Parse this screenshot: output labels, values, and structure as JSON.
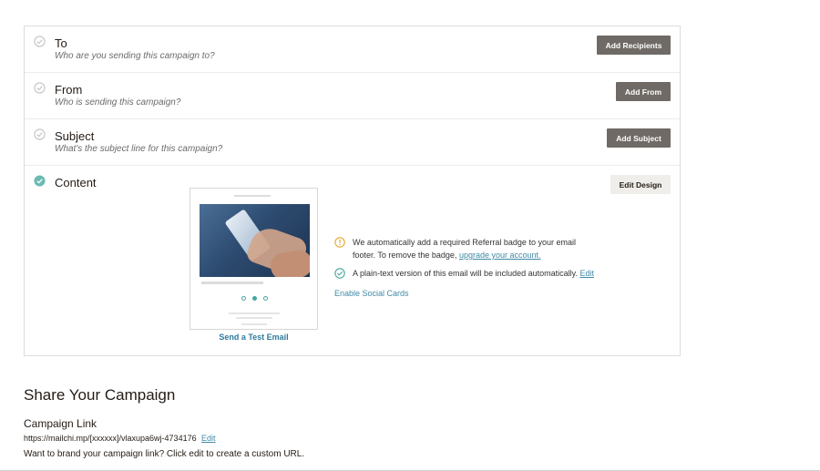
{
  "checklist": {
    "to": {
      "title": "To",
      "subtitle": "Who are you sending this campaign to?",
      "button": "Add Recipients",
      "status": "incomplete"
    },
    "from": {
      "title": "From",
      "subtitle": "Who is sending this campaign?",
      "button": "Add From",
      "status": "incomplete"
    },
    "subject": {
      "title": "Subject",
      "subtitle": "What's the subject line for this campaign?",
      "button": "Add Subject",
      "status": "incomplete"
    },
    "content": {
      "title": "Content",
      "button": "Edit Design",
      "status": "complete",
      "send_test_label": "Send a Test Email",
      "badge_notice": {
        "text_line1": "We automatically add a required Referral badge to your email",
        "text_line2": "footer. To remove the badge,",
        "link": "upgrade your account."
      },
      "plaintext_notice": {
        "text": "A plain-text version of this email will be included automatically.",
        "link": "Edit"
      },
      "social_cards_link": "Enable Social Cards"
    }
  },
  "share": {
    "title": "Share Your Campaign",
    "campaign_link_title": "Campaign Link",
    "url": "https://mailchi.mp/[xxxxxx]/vlaxupa6wj-4734176",
    "edit_label": "Edit",
    "note": "Want to brand your campaign link? Click edit to create a custom URL."
  },
  "colors": {
    "accent_teal": "#46a5a0",
    "warning_yellow": "#e8a72a",
    "button_dark": "#6f6a65",
    "button_light": "#efeeea",
    "link_blue": "#3f8aa7"
  },
  "icons": {
    "incomplete": "check-circle-outline-icon",
    "complete": "check-circle-filled-icon",
    "warning": "warning-circle-icon",
    "success": "check-circle-outline-icon"
  }
}
